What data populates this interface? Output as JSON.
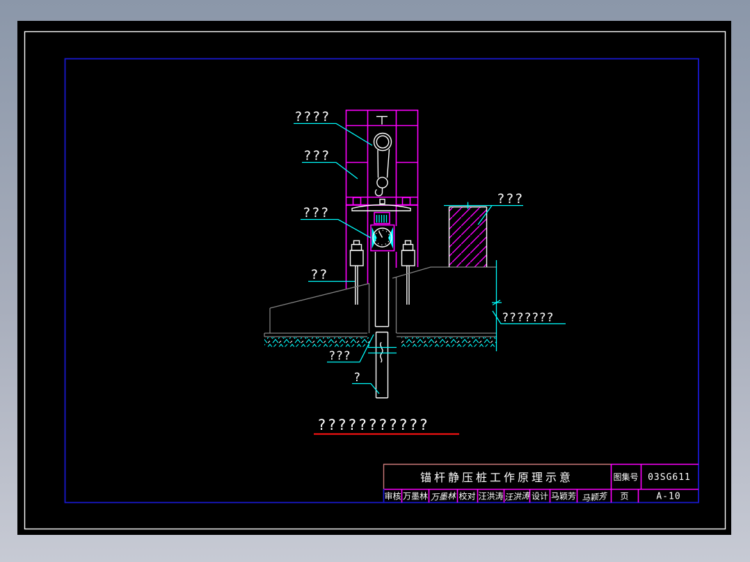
{
  "colors": {
    "background_top": "#8b97a9",
    "background_bottom": "#c7cad4",
    "paper_black": "#000000",
    "outer_border_white": "#ffffff",
    "inner_frame_blue": "#1818cf",
    "linework_magenta": "#ff00ff",
    "linework_cyan": "#00ffff",
    "linework_white": "#ffffff",
    "ground_gray": "#828282",
    "caption_underline_red": "#ee1111",
    "title_box_salmon": "#cd7a7a"
  },
  "drawing": {
    "caption": "???????????",
    "labels": {
      "hoist": "????",
      "mast": "???",
      "press_gauge": "???",
      "anchor": "??",
      "wall_top": "???",
      "depth": "???????",
      "pile_joint": "???",
      "pile_tip": "?"
    }
  },
  "title_block": {
    "drawing_title": "锚杆静压桩工作原理示意",
    "atlas_no_label": "图集号",
    "atlas_no": "03SG611",
    "page_label": "页",
    "page_no": "A-10",
    "columns": [
      {
        "role": "审核",
        "name": "万墨林",
        "signature": "万墨林"
      },
      {
        "role": "校对",
        "name": "汪洪涛",
        "signature": "汪洪涛"
      },
      {
        "role": "设计",
        "name": "马颖芳",
        "signature": "马颖芳"
      }
    ]
  }
}
